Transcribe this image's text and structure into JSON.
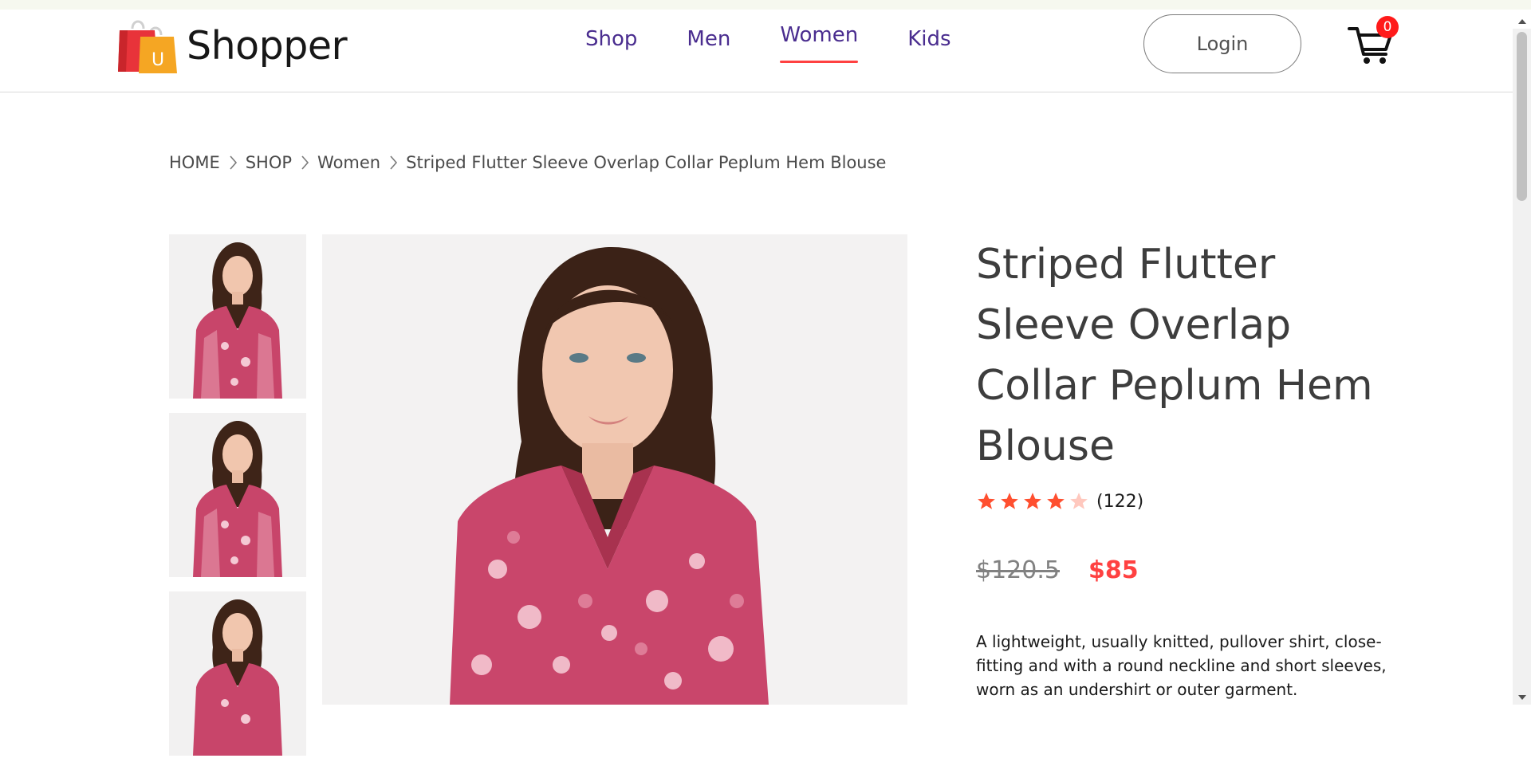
{
  "brand": {
    "name": "Shopper",
    "logo_letter": "U"
  },
  "nav": {
    "items": [
      {
        "label": "Shop",
        "active": false
      },
      {
        "label": "Men",
        "active": false
      },
      {
        "label": "Women",
        "active": true
      },
      {
        "label": "Kids",
        "active": false
      }
    ],
    "login_label": "Login",
    "cart_count": "0"
  },
  "breadcrumb": [
    "HOME",
    "SHOP",
    "Women",
    "Striped Flutter Sleeve Overlap Collar Peplum Hem Blouse"
  ],
  "product": {
    "title": "Striped Flutter Sleeve Overlap Collar Peplum Hem Blouse",
    "rating": 4,
    "rating_max": 5,
    "review_count": "(122)",
    "old_price": "$120.5",
    "new_price": "$85",
    "description": "A lightweight, usually knitted, pullover shirt, close-fitting and with a round neckline and short sleeves, worn as an undershirt or outer garment."
  },
  "colors": {
    "accent": "#ff4141",
    "nav_text": "#4a2d8f",
    "star_filled": "#ff4f2f",
    "star_empty": "#ffc8be"
  },
  "icons": [
    "cart-icon",
    "chevron-right-icon",
    "star-icon"
  ]
}
